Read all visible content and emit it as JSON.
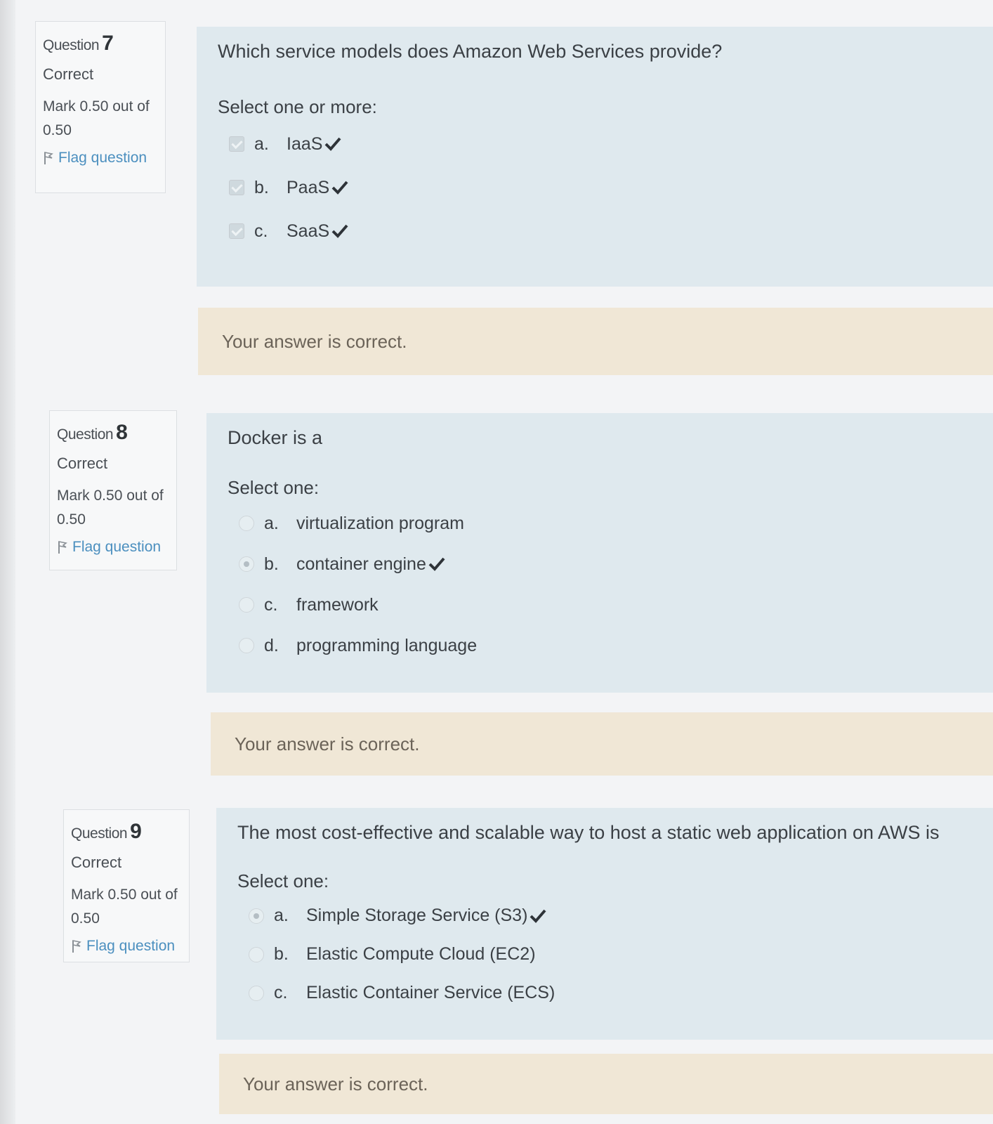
{
  "questions": [
    {
      "label": "Question",
      "number": "7",
      "state": "Correct",
      "grade_line1": "Mark 0.50 out of",
      "grade_line2": "0.50",
      "flag_label": "Flag question",
      "text": "Which service models does Amazon Web Services provide?",
      "prompt": "Select one or more:",
      "input_type": "checkbox",
      "answers": [
        {
          "letter": "a.",
          "label": "IaaS",
          "checked": true,
          "marked_correct": true
        },
        {
          "letter": "b.",
          "label": "PaaS",
          "checked": true,
          "marked_correct": true
        },
        {
          "letter": "c.",
          "label": "SaaS",
          "checked": true,
          "marked_correct": true
        }
      ],
      "feedback": "Your answer is correct."
    },
    {
      "label": "Question",
      "number": "8",
      "state": "Correct",
      "grade_line1": "Mark 0.50 out of",
      "grade_line2": "0.50",
      "flag_label": "Flag question",
      "text": "Docker is a",
      "prompt": "Select one:",
      "input_type": "radio",
      "answers": [
        {
          "letter": "a.",
          "label": "virtualization program",
          "checked": false,
          "marked_correct": false
        },
        {
          "letter": "b.",
          "label": "container engine",
          "checked": true,
          "marked_correct": true
        },
        {
          "letter": "c.",
          "label": "framework",
          "checked": false,
          "marked_correct": false
        },
        {
          "letter": "d.",
          "label": "programming language",
          "checked": false,
          "marked_correct": false
        }
      ],
      "feedback": "Your answer is correct."
    },
    {
      "label": "Question",
      "number": "9",
      "state": "Correct",
      "grade_line1": "Mark 0.50 out of",
      "grade_line2": "0.50",
      "flag_label": "Flag question",
      "text": "The most cost-effective and scalable way to host a static web application on AWS is",
      "prompt": "Select one:",
      "input_type": "radio",
      "answers": [
        {
          "letter": "a.",
          "label": "Simple Storage Service (S3)",
          "checked": true,
          "marked_correct": true
        },
        {
          "letter": "b.",
          "label": "Elastic Compute Cloud (EC2)",
          "checked": false,
          "marked_correct": false
        },
        {
          "letter": "c.",
          "label": "Elastic Container Service (ECS)",
          "checked": false,
          "marked_correct": false
        }
      ],
      "feedback": "Your answer is correct."
    }
  ],
  "colors": {
    "formulation_bg": "#dfe9ee",
    "feedback_bg": "#f0e7d6",
    "correct_tick": "#2e3338",
    "flag_link": "#4b8fbf"
  },
  "icons": {
    "correct": "check-icon",
    "flag": "flag-icon"
  }
}
